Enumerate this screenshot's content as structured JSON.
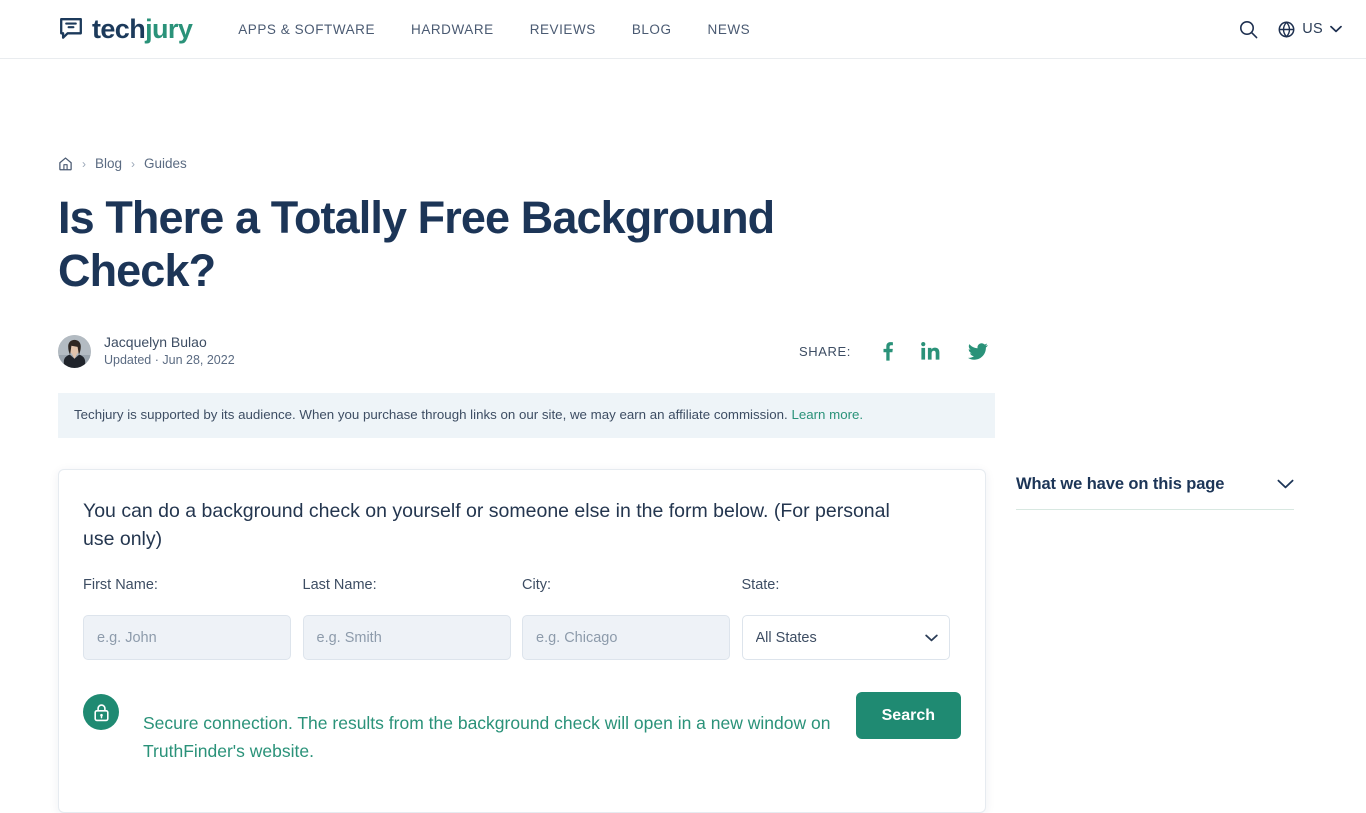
{
  "header": {
    "logo": {
      "text_primary": "tech",
      "text_accent": "jury",
      "icon": "chat-bubble-icon"
    },
    "nav": [
      {
        "label": "APPS & SOFTWARE"
      },
      {
        "label": "HARDWARE"
      },
      {
        "label": "REVIEWS"
      },
      {
        "label": "BLOG"
      },
      {
        "label": "NEWS"
      }
    ],
    "search_icon": "search-icon",
    "locale": {
      "icon": "globe-icon",
      "label": "US",
      "caret": "chevron-down-icon"
    }
  },
  "breadcrumb": {
    "home_icon": "home-icon",
    "separator": "›",
    "items": [
      {
        "label": "Blog"
      },
      {
        "label": "Guides"
      }
    ]
  },
  "article": {
    "title": "Is There a Totally Free Background Check?",
    "author": {
      "name": "Jacquelyn Bulao",
      "meta": "Updated · Jun 28, 2022",
      "avatar": "author-avatar"
    },
    "share": {
      "label": "SHARE:",
      "networks": [
        {
          "name": "facebook-icon"
        },
        {
          "name": "linkedin-icon"
        },
        {
          "name": "twitter-icon"
        }
      ]
    },
    "disclaimer": {
      "text": "Techjury is supported by its audience. When you purchase through links on our site, we may earn an affiliate commission.",
      "link_label": "Learn more."
    }
  },
  "form": {
    "heading": "You can do a background check on yourself or someone else in the form below. (For personal use only)",
    "fields": [
      {
        "label": "First Name:",
        "placeholder": "e.g. John",
        "value": ""
      },
      {
        "label": "Last Name:",
        "placeholder": "e.g. Smith",
        "value": ""
      },
      {
        "label": "City:",
        "placeholder": "e.g. Chicago",
        "value": ""
      }
    ],
    "state": {
      "label": "State:",
      "selected": "All States",
      "options": [
        "All States"
      ]
    },
    "secure": {
      "icon": "lock-icon",
      "text": "Secure connection. The results from the background check will open in a new window on TruthFinder's website."
    },
    "submit_label": "Search"
  },
  "sidebar": {
    "toc": {
      "title": "What we have on this page",
      "caret": "chevron-down-icon"
    }
  },
  "colors": {
    "brand_teal": "#2a9279",
    "button_teal": "#1f8a72",
    "navy": "#1c3557",
    "muted": "#5b6b82",
    "disclaimer_bg": "#eef4f8",
    "input_bg": "#eef2f7"
  }
}
